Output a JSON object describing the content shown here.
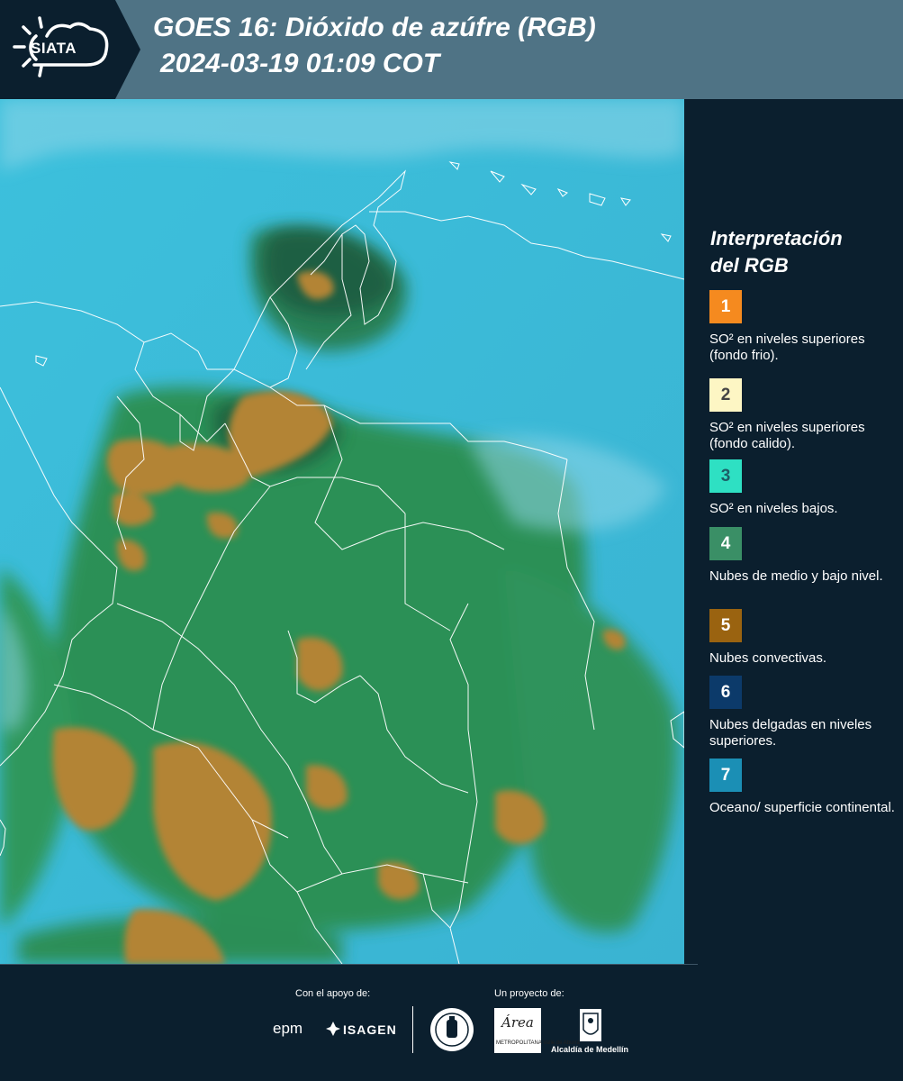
{
  "header": {
    "logo": "SIATA",
    "title": "GOES 16: Dióxido de azúfre (RGB)",
    "subtitle": "2024-03-19 01:09 COT"
  },
  "legend": {
    "title_line1": "Interpretación",
    "title_line2": "del RGB",
    "items": [
      {
        "number": "1",
        "label": "SO² en niveles superiores (fondo frio).",
        "color": "#f58a1f",
        "text_color": "#ffffff"
      },
      {
        "number": "2",
        "label": "SO² en niveles superiores (fondo calido).",
        "color": "#fdf6c4",
        "text_color": "#444444"
      },
      {
        "number": "3",
        "label": "SO² en niveles bajos.",
        "color": "#2ee0c3",
        "text_color": "#1d5e66"
      },
      {
        "number": "4",
        "label": "Nubes de medio y bajo nivel.",
        "color": "#3a8f66",
        "text_color": "#ffffff"
      },
      {
        "number": "5",
        "label": "Nubes convectivas.",
        "color": "#9a6310",
        "text_color": "#ffffff"
      },
      {
        "number": "6",
        "label": "Nubes delgadas en niveles superiores.",
        "color": "#0c3a6a",
        "text_color": "#ffffff"
      },
      {
        "number": "7",
        "label": "Oceano/ superficie continental.",
        "color": "#1b8fb5",
        "text_color": "#ffffff"
      }
    ]
  },
  "footer": {
    "support_label": "Con el apoyo de:",
    "project_label": "Un proyecto de:",
    "epm": "epm",
    "isagen": "ISAGEN",
    "area_word": "Área",
    "area_sub": "METROPOLITANA Valle de Aburrá",
    "alcaldia": "Alcaldía de Medellín"
  },
  "colors": {
    "background": "#0b1f2e",
    "header_band": "#4f7385",
    "ocean": "#35b9d6",
    "land_green": "#2f8f48",
    "convective": "#b8883a"
  }
}
